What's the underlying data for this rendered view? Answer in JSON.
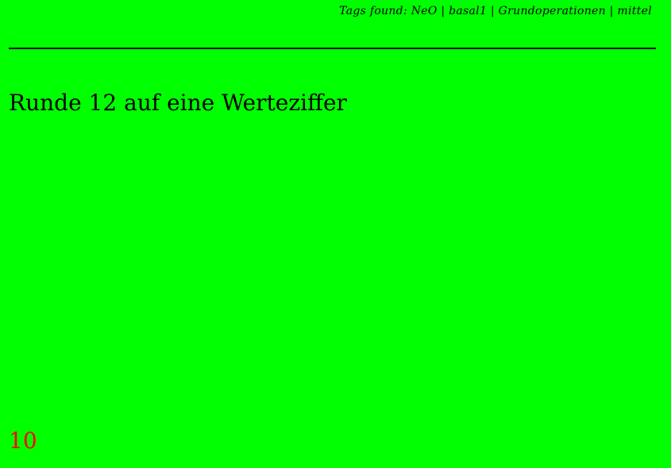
{
  "header": {
    "tags_text": "Tags found: NeO | basal1 | Grundoperationen | mittel"
  },
  "content": {
    "task_text": "Runde 12 auf eine Werteziffer"
  },
  "footer": {
    "page_number": "10"
  },
  "colors": {
    "background": "#00ff00",
    "text": "#000000",
    "page_number": "#ff0000"
  }
}
